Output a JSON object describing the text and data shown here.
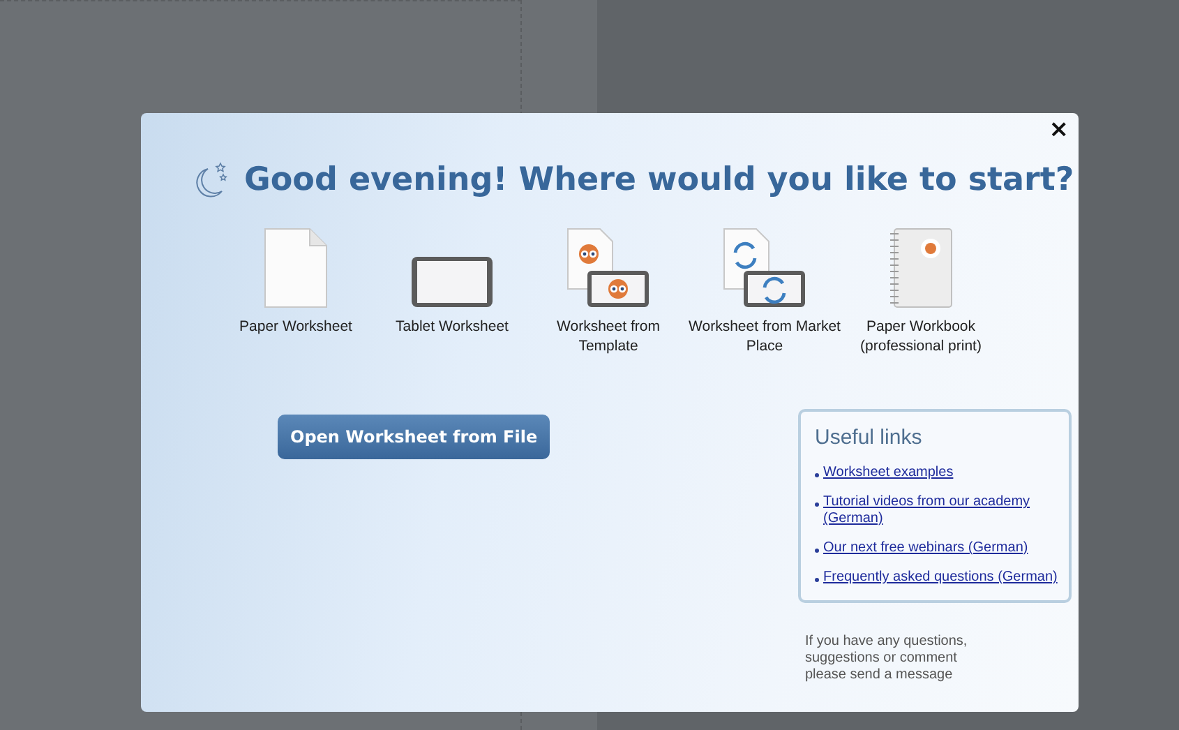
{
  "dialog": {
    "close": "×",
    "greeting": "Good evening! Where would you like to start?",
    "options": [
      {
        "kind": "paper",
        "label": "Paper Worksheet"
      },
      {
        "kind": "tablet",
        "label": "Tablet Worksheet"
      },
      {
        "kind": "template",
        "label": "Worksheet from Template"
      },
      {
        "kind": "market",
        "label": "Worksheet from Market Place"
      },
      {
        "kind": "workbook",
        "label": "Paper Workbook (professional print)"
      }
    ],
    "open_button": "Open Worksheet from File",
    "useful_links": {
      "title": "Useful links",
      "links": [
        "Worksheet examples",
        "Tutorial videos from our academy (German)",
        "Our next free webinars (German)",
        "Frequently asked questions (German)"
      ]
    },
    "footer_lines": [
      "If you have any questions,",
      "suggestions or comment",
      "please send a message"
    ]
  }
}
